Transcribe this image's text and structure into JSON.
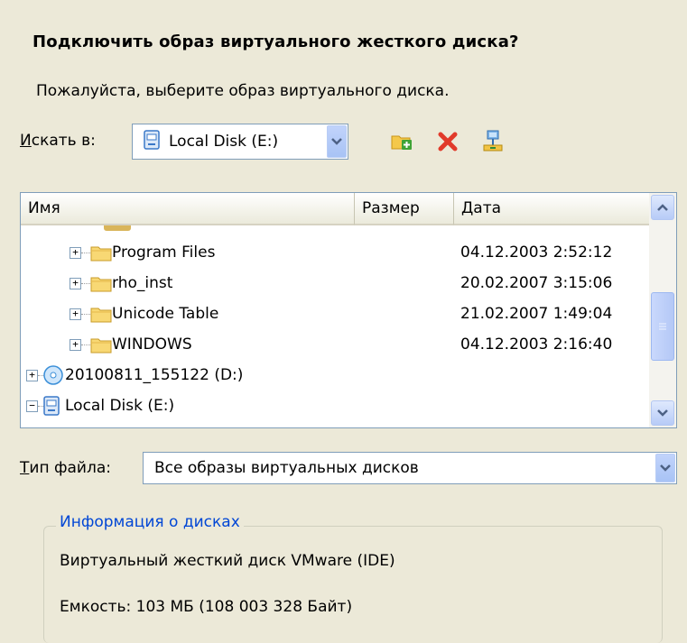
{
  "dialog": {
    "title": "Подключить образ виртуального жесткого диска?",
    "subtitle": "Пожалуйста, выберите образ виртуального диска."
  },
  "look_in": {
    "label_accel": "И",
    "label_rest": "скать в:",
    "value": "Local Disk (E:)"
  },
  "toolbar": {
    "icons": [
      "new-folder-icon",
      "delete-icon",
      "network-icon"
    ]
  },
  "file_list": {
    "columns": [
      "Имя",
      "Размер",
      "Дата"
    ],
    "rows": [
      {
        "name": "Program Files",
        "date": "04.12.2003 2:52:12"
      },
      {
        "name": "rho_inst",
        "date": "20.02.2007 3:15:06"
      },
      {
        "name": "Unicode Table",
        "date": "21.02.2007 1:49:04"
      },
      {
        "name": "WINDOWS",
        "date": "04.12.2003 2:16:40"
      },
      {
        "name": "20100811_155122 (D:)",
        "date": ""
      },
      {
        "name": "Local Disk (E:)",
        "date": ""
      }
    ]
  },
  "file_type": {
    "label_accel": "Т",
    "label_rest": "ип файла:",
    "value": "Все образы виртуальных дисков"
  },
  "disk_info": {
    "title": "Информация о дисках",
    "line1": "Виртуальный жесткий диск VMware (IDE)",
    "line2": "Емкость:  103 МБ (108 003 328 Байт)"
  },
  "colors": {
    "background": "#ece9d8",
    "group_title": "#0046d5",
    "combo_border": "#7f9db9"
  }
}
